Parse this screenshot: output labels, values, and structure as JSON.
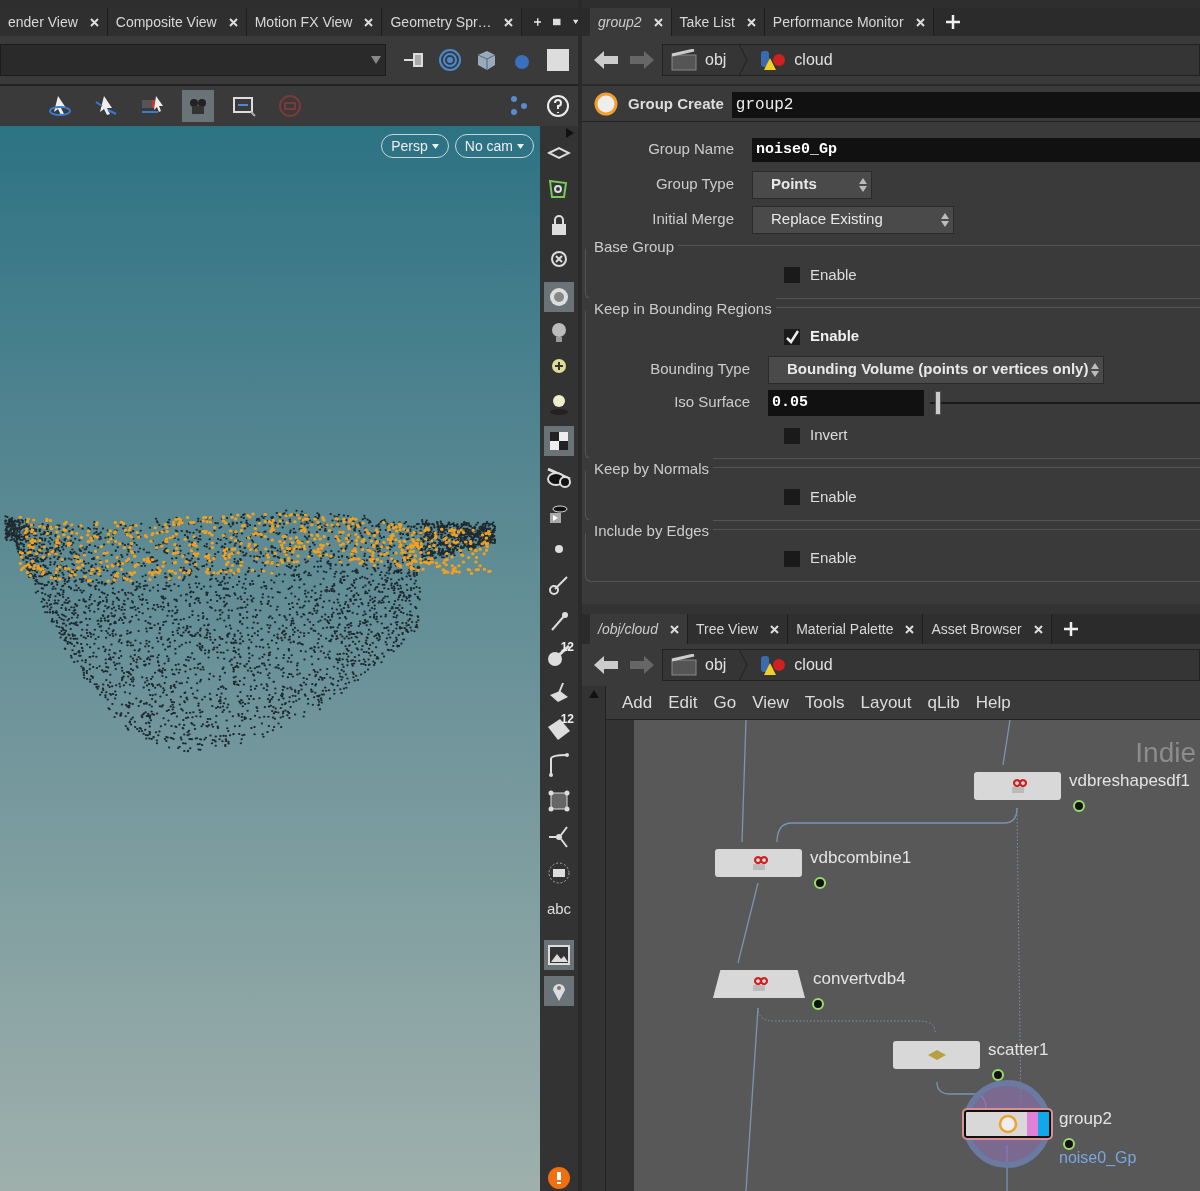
{
  "viewer_tabs": [
    {
      "label": "ender View",
      "selected": false
    },
    {
      "label": "Composite View",
      "selected": false
    },
    {
      "label": "Motion FX View",
      "selected": false
    },
    {
      "label": "Geometry Spr…",
      "selected": false
    }
  ],
  "viewer_toolbar": [
    {
      "selected": false
    },
    {
      "selected": false
    },
    {
      "selected": false
    },
    {
      "selected": true
    },
    {
      "selected": false
    },
    {
      "selected": false
    }
  ],
  "viewport": {
    "camera_buttons": [
      "Persp",
      "No cam"
    ]
  },
  "side_toolbar": [
    {
      "kind": "icon",
      "selected": false
    },
    {
      "kind": "icon",
      "selected": false
    },
    {
      "kind": "icon",
      "selected": false
    },
    {
      "kind": "icon",
      "selected": false
    },
    {
      "kind": "icon",
      "selected": true
    },
    {
      "kind": "icon",
      "selected": false
    },
    {
      "kind": "icon",
      "selected": false
    },
    {
      "kind": "icon",
      "selected": false
    },
    {
      "kind": "icon",
      "selected": true
    },
    {
      "kind": "icon",
      "selected": false
    },
    {
      "kind": "icon",
      "selected": false
    },
    {
      "kind": "icon",
      "selected": false
    },
    {
      "kind": "icon",
      "selected": false
    },
    {
      "kind": "icon",
      "selected": false
    },
    {
      "kind": "numbered",
      "label": "12",
      "selected": false
    },
    {
      "kind": "icon",
      "selected": false
    },
    {
      "kind": "numbered",
      "label": "12",
      "selected": false
    },
    {
      "kind": "icon",
      "selected": false
    },
    {
      "kind": "icon",
      "selected": false
    },
    {
      "kind": "icon",
      "selected": false
    },
    {
      "kind": "icon",
      "selected": false
    },
    {
      "kind": "text",
      "label": "abc",
      "selected": false
    },
    {
      "kind": "icon",
      "selected": true
    },
    {
      "kind": "icon",
      "selected": true
    }
  ],
  "param_tabs": [
    {
      "label": "group2",
      "selected": true
    },
    {
      "label": "Take List",
      "selected": false
    },
    {
      "label": "Performance Monitor",
      "selected": false
    }
  ],
  "param_path": [
    "obj",
    "cloud"
  ],
  "parameters": {
    "node_type": "Group Create",
    "node_name": "group2",
    "fields": [
      {
        "kind": "text",
        "label": "Group Name",
        "value": "noise0_Gp"
      },
      {
        "kind": "menu",
        "label": "Group Type",
        "value": "Points"
      },
      {
        "kind": "menu",
        "label": "Initial Merge",
        "value": "Replace Existing"
      }
    ],
    "sections": [
      {
        "title": "Base Group",
        "rows": [
          {
            "kind": "checkbox",
            "label": "Enable",
            "checked": false
          }
        ]
      },
      {
        "title": "Keep in Bounding Regions",
        "rows": [
          {
            "kind": "checkbox",
            "label": "Enable",
            "checked": true
          },
          {
            "kind": "menu",
            "label": "Bounding Type",
            "value": "Bounding Volume (points or vertices only)"
          },
          {
            "kind": "slider",
            "label": "Iso Surface",
            "value": "0.05",
            "level": 0.02
          },
          {
            "kind": "checkbox",
            "label": "Invert",
            "checked": false
          }
        ]
      },
      {
        "title": "Keep by Normals",
        "rows": [
          {
            "kind": "checkbox",
            "label": "Enable",
            "checked": false
          }
        ]
      },
      {
        "title": "Include by Edges",
        "rows": [
          {
            "kind": "checkbox",
            "label": "Enable",
            "checked": false
          }
        ]
      }
    ]
  },
  "network_tabs": [
    {
      "label": "/obj/cloud",
      "selected": true
    },
    {
      "label": "Tree View",
      "selected": false
    },
    {
      "label": "Material Palette",
      "selected": false
    },
    {
      "label": "Asset Browser",
      "selected": false
    }
  ],
  "network_path": [
    "obj",
    "cloud"
  ],
  "network_menu": [
    "Add",
    "Edit",
    "Go",
    "View",
    "Tools",
    "Layout",
    "qLib",
    "Help"
  ],
  "network": {
    "corner_text": "Indie",
    "nodes": [
      {
        "name": "vdbreshapesdf1",
        "kind": "vdb",
        "selected": false
      },
      {
        "name": "vdbcombine1",
        "kind": "vdb",
        "selected": false
      },
      {
        "name": "convertvdb4",
        "kind": "vdb_convert",
        "selected": false
      },
      {
        "name": "scatter1",
        "kind": "scatter",
        "selected": false
      },
      {
        "name": "group2",
        "kind": "group",
        "selected": true,
        "group_label": "noise0_Gp"
      }
    ]
  }
}
